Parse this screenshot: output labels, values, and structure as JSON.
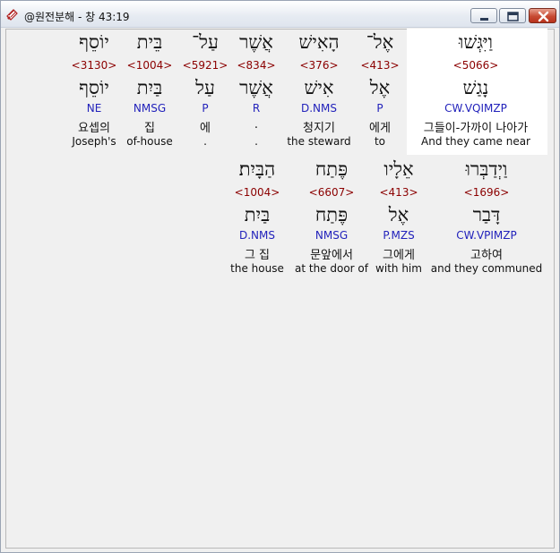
{
  "window": {
    "title": "@원전분해 - 창 43:19"
  },
  "line1": [
    {
      "hebrew": "וַיִּגְּשׁוּ",
      "strong": "<5066>",
      "lexeme": "נָגַשׁ",
      "parse": "CW.VQIMZP",
      "korean": "그들이-가까이 나아가",
      "english": "And they came near",
      "selected": true
    },
    {
      "hebrew": "אֶל־",
      "strong": "<413>",
      "lexeme": "אֶל",
      "parse": "P",
      "korean": "에게",
      "english": "to"
    },
    {
      "hebrew": "הָאִישׁ",
      "strong": "<376>",
      "lexeme": "אִישׁ",
      "parse": "D.NMS",
      "korean": "청지기",
      "english": "the steward"
    },
    {
      "hebrew": "אֲשֶׁר",
      "strong": "<834>",
      "lexeme": "אֲשֶׁר",
      "parse": "R",
      "korean": ".",
      "english": "."
    },
    {
      "hebrew": "עַל־",
      "strong": "<5921>",
      "lexeme": "עַל",
      "parse": "P",
      "korean": "에",
      "english": "."
    },
    {
      "hebrew": "בֵּית",
      "strong": "<1004>",
      "lexeme": "בַּיִת",
      "parse": "NMSG",
      "korean": "집",
      "english": "of-house"
    },
    {
      "hebrew": "יוֹסֵף",
      "strong": "<3130>",
      "lexeme": "יוֹסֵף",
      "parse": "NE",
      "korean": "요셉의",
      "english": "Joseph's"
    }
  ],
  "line2": [
    {
      "hebrew": "וַיְדַבְּרוּ",
      "strong": "<1696>",
      "lexeme": "דָּבַר",
      "parse": "CW.VPIMZP",
      "korean": "고하여",
      "english": "and they communed"
    },
    {
      "hebrew": "אֵלָיו",
      "strong": "<413>",
      "lexeme": "אֶל",
      "parse": "P.MZS",
      "korean": "그에게",
      "english": "with him"
    },
    {
      "hebrew": "פֶּתַח",
      "strong": "<6607>",
      "lexeme": "פֶּתַח",
      "parse": "NMSG",
      "korean": "문앞에서",
      "english": "at the door of"
    },
    {
      "hebrew": "הַבָּיִת׃",
      "strong": "<1004>",
      "lexeme": "בַּיִת",
      "parse": "D.NMS",
      "korean": "그 집",
      "english": "the house"
    }
  ],
  "colors": {
    "strong": "#8b0000",
    "parse": "#2222bb",
    "selected_bg": "#ffffff"
  }
}
